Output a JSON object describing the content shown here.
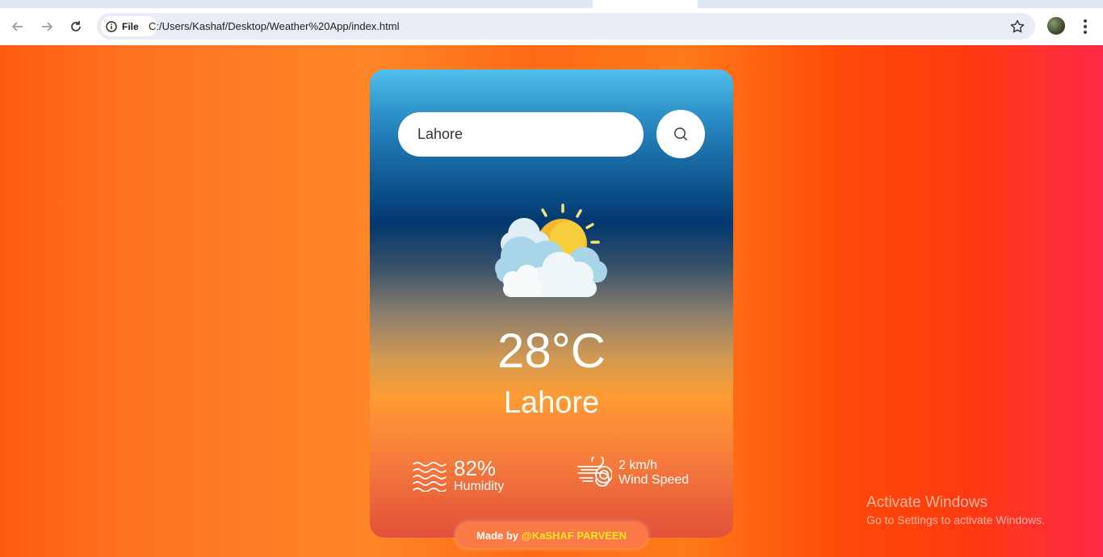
{
  "browser": {
    "chip_label": "File",
    "url": "C:/Users/Kashaf/Desktop/Weather%20App/index.html"
  },
  "app": {
    "search": {
      "value": "Lahore"
    },
    "weather_icon": "sun-behind-clouds-icon",
    "temperature": "28°C",
    "city": "Lahore",
    "humidity": {
      "value": "82%",
      "label": "Humidity",
      "icon": "humidity-waves-icon"
    },
    "wind": {
      "value": "2 km/h",
      "label": "Wind Speed",
      "icon": "wind-icon"
    },
    "credit": {
      "prefix": "Made by",
      "author": "@KaSHAF PARVEEN"
    }
  },
  "watermark": {
    "title": "Activate Windows",
    "subtitle": "Go to Settings to activate Windows."
  },
  "colors": {
    "credit_author": "#ffe62b",
    "card_top": "#4fc0ec",
    "card_bottom": "#e2503a"
  }
}
